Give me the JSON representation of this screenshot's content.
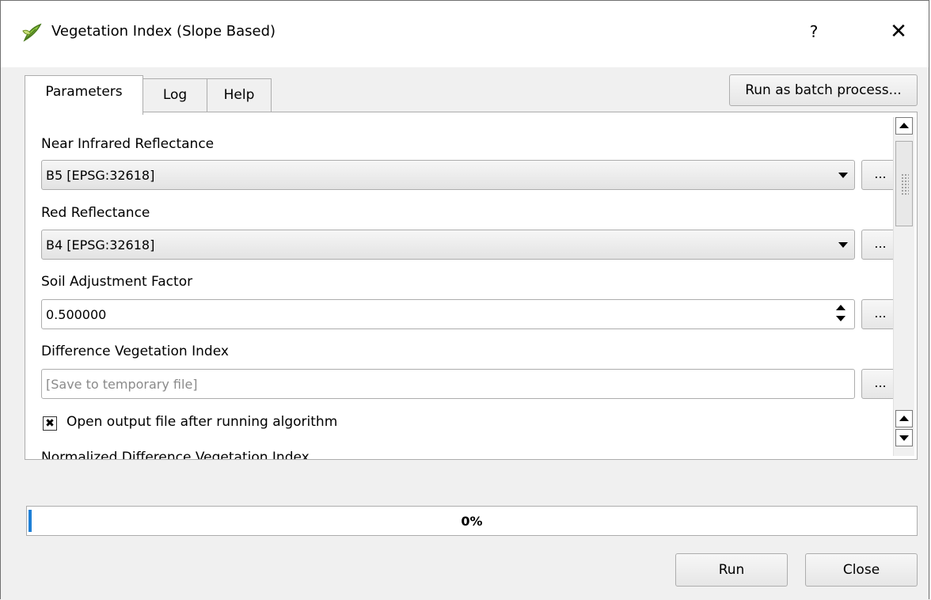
{
  "window": {
    "title": "Vegetation Index (Slope Based)",
    "help_label": "?",
    "close_label": "✕"
  },
  "tabs": [
    {
      "label": "Parameters",
      "active": true
    },
    {
      "label": "Log",
      "active": false
    },
    {
      "label": "Help",
      "active": false
    }
  ],
  "batch_button_label": "Run as batch process...",
  "params": {
    "nir": {
      "label": "Near Infrared Reflectance",
      "value": "B5 [EPSG:32618]",
      "browse_label": "..."
    },
    "red": {
      "label": "Red Reflectance",
      "value": "B4 [EPSG:32618]",
      "browse_label": "..."
    },
    "soil": {
      "label": "Soil Adjustment Factor",
      "value": "0.500000",
      "browse_label": "..."
    },
    "dvi": {
      "label": "Difference Vegetation Index",
      "placeholder": "[Save to temporary file]",
      "browse_label": "..."
    },
    "open_output": {
      "label": "Open output file after running algorithm",
      "checked": true,
      "mark": "✖"
    },
    "ndvi": {
      "label": "Normalized Difference Vegetation Index"
    }
  },
  "progress": {
    "value": 0,
    "text": "0%"
  },
  "buttons": {
    "run": "Run",
    "close": "Close"
  },
  "colors": {
    "progress_accent": "#1e7fd6",
    "window_bg": "#f0f0f0"
  }
}
